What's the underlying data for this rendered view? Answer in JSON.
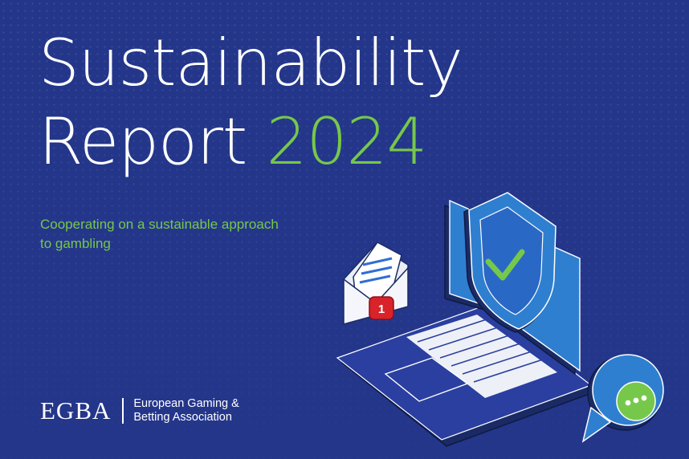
{
  "cover": {
    "title_line1": "Sustainability",
    "title_line2": "Report",
    "title_year": "2024",
    "subtitle": "Cooperating on a sustainable approach to gambling"
  },
  "logo": {
    "mark": "EGBA",
    "name_line1": "European Gaming &",
    "name_line2": "Betting Association"
  },
  "illustration": {
    "notification_count": "1",
    "icons": [
      "envelope-icon",
      "laptop-icon",
      "shield-check-icon",
      "chat-bubble-icon"
    ]
  },
  "colors": {
    "background": "#24368a",
    "accent_green": "#76c84a",
    "text": "#ffffff",
    "laptop_screen": "#2f7fd0",
    "notification_red": "#d8232a"
  }
}
